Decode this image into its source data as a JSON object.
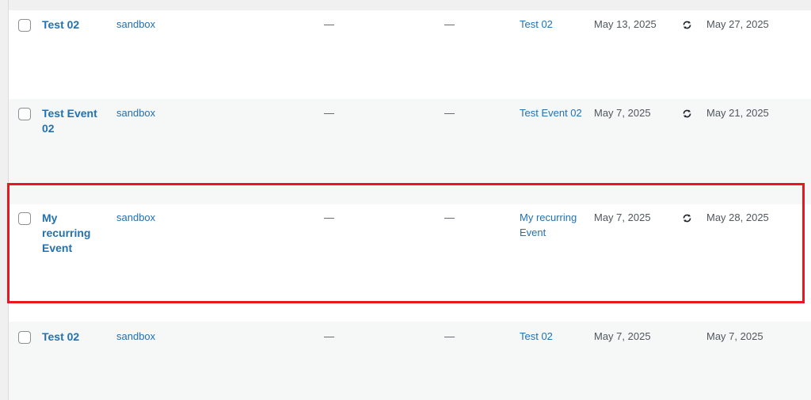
{
  "rows": [
    {
      "title": "Test 02",
      "author": "sandbox",
      "col3": "—",
      "col4": "—",
      "event": "Test 02",
      "start_date": "May 13, 2025",
      "recurring": true,
      "end_date": "May 27, 2025"
    },
    {
      "title": "Test Event 02",
      "author": "sandbox",
      "col3": "—",
      "col4": "—",
      "event": "Test Event 02",
      "start_date": "May 7, 2025",
      "recurring": true,
      "end_date": "May 21, 2025"
    },
    {
      "title": "My recurring Event",
      "author": "sandbox",
      "col3": "—",
      "col4": "—",
      "event": "My recurring Event",
      "start_date": "May 7, 2025",
      "recurring": true,
      "end_date": "May 28, 2025",
      "highlighted": true
    },
    {
      "title": "Test 02",
      "author": "sandbox",
      "col3": "—",
      "col4": "—",
      "event": "Test 02",
      "start_date": "May 7, 2025",
      "recurring": false,
      "end_date": "May 7, 2025"
    }
  ],
  "colors": {
    "link": "#2271b1",
    "text": "#50575e",
    "highlight_border": "#e8181e",
    "row_alt": "#f6f7f7"
  },
  "icons": {
    "recurring": "recurring-icon"
  }
}
